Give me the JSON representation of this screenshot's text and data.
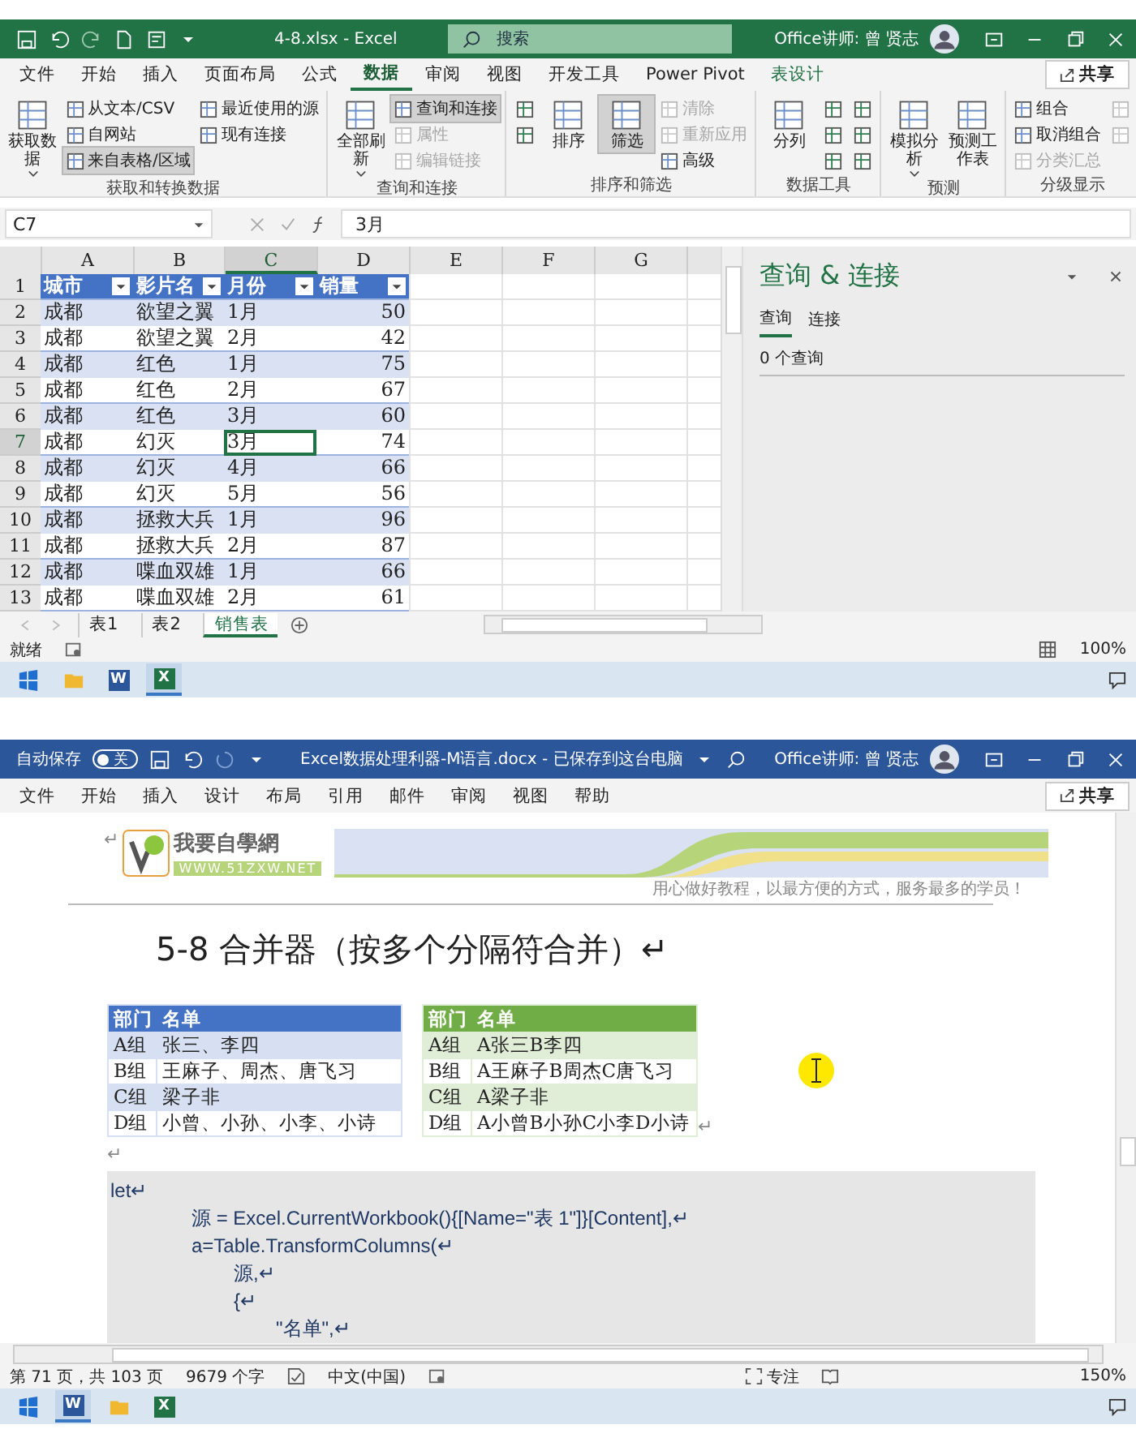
{
  "excel": {
    "title_bar": {
      "filename": "4-8.xlsx  -  Excel",
      "search_placeholder": "搜索",
      "user": "Office讲师: 曾 贤志"
    },
    "menu_tabs": [
      {
        "label": "文件",
        "selected": false,
        "kind": "plain"
      },
      {
        "label": "开始",
        "selected": false,
        "kind": "plain"
      },
      {
        "label": "插入",
        "selected": false,
        "kind": "plain"
      },
      {
        "label": "页面布局",
        "selected": false,
        "kind": "plain"
      },
      {
        "label": "公式",
        "selected": false,
        "kind": "plain"
      },
      {
        "label": "数据",
        "selected": true,
        "kind": "plain"
      },
      {
        "label": "审阅",
        "selected": false,
        "kind": "plain"
      },
      {
        "label": "视图",
        "selected": false,
        "kind": "plain"
      },
      {
        "label": "开发工具",
        "selected": false,
        "kind": "plain"
      },
      {
        "label": "Power Pivot",
        "selected": false,
        "kind": "plain"
      },
      {
        "label": "表设计",
        "selected": false,
        "kind": "contextual"
      }
    ],
    "share": "共享",
    "ribbon": [
      {
        "label": "获取和转换数据",
        "items": [
          {
            "kind": "big",
            "label": "获取数据",
            "dropdown": true,
            "selected": false,
            "disabled": false
          },
          {
            "kind": "stack",
            "entries": [
              {
                "label": "从文本/CSV",
                "disabled": false,
                "selected": false
              },
              {
                "label": "自网站",
                "disabled": false,
                "selected": false
              },
              {
                "label": "来自表格/区域",
                "disabled": false,
                "selected": true
              }
            ]
          },
          {
            "kind": "stack",
            "entries": [
              {
                "label": "最近使用的源",
                "disabled": false,
                "selected": false
              },
              {
                "label": "现有连接",
                "disabled": false,
                "selected": false
              }
            ]
          }
        ]
      },
      {
        "label": "查询和连接",
        "items": [
          {
            "kind": "big",
            "label": "全部刷新",
            "dropdown": true,
            "selected": false,
            "disabled": false
          },
          {
            "kind": "stack",
            "entries": [
              {
                "label": "查询和连接",
                "disabled": false,
                "selected": true
              },
              {
                "label": "属性",
                "disabled": true,
                "selected": false
              },
              {
                "label": "编辑链接",
                "disabled": true,
                "selected": false
              }
            ]
          }
        ]
      },
      {
        "label": "排序和筛选",
        "items": [
          {
            "kind": "iconstack",
            "entries": [
              {
                "disabled": false
              },
              {
                "disabled": false
              }
            ]
          },
          {
            "kind": "big",
            "label": "排序",
            "dropdown": false,
            "selected": false,
            "disabled": false
          },
          {
            "kind": "big",
            "label": "筛选",
            "dropdown": false,
            "selected": true,
            "disabled": false
          },
          {
            "kind": "stack",
            "entries": [
              {
                "label": "清除",
                "disabled": true,
                "selected": false
              },
              {
                "label": "重新应用",
                "disabled": true,
                "selected": false
              },
              {
                "label": "高级",
                "disabled": false,
                "selected": false
              }
            ]
          }
        ]
      },
      {
        "label": "数据工具",
        "items": [
          {
            "kind": "big",
            "label": "分列",
            "dropdown": false,
            "selected": false,
            "disabled": false
          },
          {
            "kind": "iconstack",
            "entries": [
              {
                "disabled": false
              },
              {
                "disabled": false
              },
              {
                "disabled": false
              }
            ]
          },
          {
            "kind": "iconstack",
            "entries": [
              {
                "disabled": false
              },
              {
                "disabled": false
              },
              {
                "disabled": false
              }
            ]
          }
        ]
      },
      {
        "label": "预测",
        "items": [
          {
            "kind": "big",
            "label": "模拟分析",
            "dropdown": true,
            "selected": false,
            "disabled": false
          },
          {
            "kind": "big",
            "label": "预测工作表",
            "dropdown": false,
            "selected": false,
            "disabled": false
          }
        ]
      },
      {
        "label": "分级显示",
        "items": [
          {
            "kind": "stack",
            "entries": [
              {
                "label": "组合",
                "disabled": false,
                "selected": false
              },
              {
                "label": "取消组合",
                "disabled": false,
                "selected": false
              },
              {
                "label": "分类汇总",
                "disabled": true,
                "selected": false
              }
            ]
          },
          {
            "kind": "iconstack",
            "entries": [
              {
                "disabled": true
              },
              {
                "disabled": true
              }
            ]
          }
        ]
      }
    ],
    "name_box": "C7",
    "formula": "3月",
    "columns": [
      "A",
      "B",
      "C",
      "D",
      "E",
      "F",
      "G"
    ],
    "header_row_number": "1",
    "table_header": [
      "城市",
      "影片名",
      "月份",
      "销量"
    ],
    "rows": [
      {
        "number": "2",
        "cells": [
          {
            "text": "成都",
            "selected": false
          },
          {
            "text": "欲望之翼",
            "selected": false
          },
          {
            "text": "1月",
            "selected": false
          },
          {
            "text": "50",
            "selected": false
          }
        ]
      },
      {
        "number": "3",
        "cells": [
          {
            "text": "成都",
            "selected": false
          },
          {
            "text": "欲望之翼",
            "selected": false
          },
          {
            "text": "2月",
            "selected": false
          },
          {
            "text": "42",
            "selected": false
          }
        ]
      },
      {
        "number": "4",
        "cells": [
          {
            "text": "成都",
            "selected": false
          },
          {
            "text": "红色",
            "selected": false
          },
          {
            "text": "1月",
            "selected": false
          },
          {
            "text": "75",
            "selected": false
          }
        ]
      },
      {
        "number": "5",
        "cells": [
          {
            "text": "成都",
            "selected": false
          },
          {
            "text": "红色",
            "selected": false
          },
          {
            "text": "2月",
            "selected": false
          },
          {
            "text": "67",
            "selected": false
          }
        ]
      },
      {
        "number": "6",
        "cells": [
          {
            "text": "成都",
            "selected": false
          },
          {
            "text": "红色",
            "selected": false
          },
          {
            "text": "3月",
            "selected": false
          },
          {
            "text": "60",
            "selected": false
          }
        ]
      },
      {
        "number": "7",
        "cells": [
          {
            "text": "成都",
            "selected": false
          },
          {
            "text": "幻灭",
            "selected": false
          },
          {
            "text": "3月",
            "selected": true
          },
          {
            "text": "74",
            "selected": false
          }
        ]
      },
      {
        "number": "8",
        "cells": [
          {
            "text": "成都",
            "selected": false
          },
          {
            "text": "幻灭",
            "selected": false
          },
          {
            "text": "4月",
            "selected": false
          },
          {
            "text": "66",
            "selected": false
          }
        ]
      },
      {
        "number": "9",
        "cells": [
          {
            "text": "成都",
            "selected": false
          },
          {
            "text": "幻灭",
            "selected": false
          },
          {
            "text": "5月",
            "selected": false
          },
          {
            "text": "56",
            "selected": false
          }
        ]
      },
      {
        "number": "10",
        "cells": [
          {
            "text": "成都",
            "selected": false
          },
          {
            "text": "拯救大兵",
            "selected": false
          },
          {
            "text": "1月",
            "selected": false
          },
          {
            "text": "96",
            "selected": false
          }
        ]
      },
      {
        "number": "11",
        "cells": [
          {
            "text": "成都",
            "selected": false
          },
          {
            "text": "拯救大兵",
            "selected": false
          },
          {
            "text": "2月",
            "selected": false
          },
          {
            "text": "87",
            "selected": false
          }
        ]
      },
      {
        "number": "12",
        "cells": [
          {
            "text": "成都",
            "selected": false
          },
          {
            "text": "喋血双雄",
            "selected": false
          },
          {
            "text": "1月",
            "selected": false
          },
          {
            "text": "66",
            "selected": false
          }
        ]
      },
      {
        "number": "13",
        "cells": [
          {
            "text": "成都",
            "selected": false
          },
          {
            "text": "喋血双雄",
            "selected": false
          },
          {
            "text": "2月",
            "selected": false
          },
          {
            "text": "61",
            "selected": false
          }
        ]
      }
    ],
    "sheet_tabs": [
      {
        "label": "表1",
        "selected": false
      },
      {
        "label": "表2",
        "selected": false
      },
      {
        "label": "销售表",
        "selected": true
      }
    ],
    "query_pane": {
      "title": "查询 & 连接",
      "tabs": [
        {
          "label": "查询",
          "selected": true
        },
        {
          "label": "连接",
          "selected": false
        }
      ],
      "summary": "0 个查询"
    },
    "status": {
      "text": "就绪",
      "zoom": "100%"
    },
    "taskbar": [
      {
        "kind": "start",
        "active": false
      },
      {
        "kind": "explorer",
        "active": false
      },
      {
        "kind": "word",
        "letter": "W",
        "active": false
      },
      {
        "kind": "excel",
        "letter": "X",
        "active": true
      }
    ]
  },
  "word": {
    "title_bar": {
      "autosave_label": "自动保存",
      "autosave": {
        "on": false,
        "label": "关"
      },
      "filename": "Excel数据处理利器-M语言.docx  -  已保存到这台电脑",
      "user": "Office讲师: 曾 贤志"
    },
    "menu_tabs": [
      {
        "label": "文件",
        "selected": false
      },
      {
        "label": "开始",
        "selected": false
      },
      {
        "label": "插入",
        "selected": false
      },
      {
        "label": "设计",
        "selected": false
      },
      {
        "label": "布局",
        "selected": false
      },
      {
        "label": "引用",
        "selected": false
      },
      {
        "label": "邮件",
        "selected": false
      },
      {
        "label": "审阅",
        "selected": false
      },
      {
        "label": "视图",
        "selected": false
      },
      {
        "label": "帮助",
        "selected": false
      }
    ],
    "share": "共享",
    "document": {
      "header": {
        "mark": "↵",
        "logo_title": "我要自學網",
        "logo_url": "WWW.51ZXW.NET",
        "tagline": "用心做好教程，以最方便的方式，服务最多的学员！"
      },
      "heading": "5-8 合并器（按多个分隔符合并）↵",
      "tables": [
        {
          "color": "#4472c4",
          "columns": [
            "部门",
            "名单"
          ],
          "rows": [
            [
              "A组",
              "张三、李四"
            ],
            [
              "B组",
              "王麻子、周杰、唐飞习"
            ],
            [
              "C组",
              "梁子非"
            ],
            [
              "D组",
              "小曾、小孙、小李、小诗"
            ]
          ]
        },
        {
          "color": "#70ad47",
          "columns": [
            "部门",
            "名单"
          ],
          "rows": [
            [
              "A组",
              "A张三B李四"
            ],
            [
              "B组",
              "A王麻子B周杰C唐飞习"
            ],
            [
              "C组",
              "A梁子非"
            ],
            [
              "D组",
              "A小曾B小孙C小李D小诗"
            ]
          ]
        }
      ],
      "table_end_mark": "↵",
      "empty_paragraph": "↵",
      "code": [
        {
          "text": "let↵",
          "children": [
            {
              "text": "源  = Excel.CurrentWorkbook(){[Name=\"表 1\"]}[Content],↵"
            },
            {
              "text": "a=Table.TransformColumns(↵",
              "children": [
                {
                  "text": "源,↵"
                },
                {
                  "text": "{↵",
                  "children": [
                    {
                      "text": "\"名单\",↵"
                    }
                  ]
                }
              ]
            }
          ]
        }
      ]
    },
    "status": {
      "page": "第 71 页，共 103 页",
      "words": "9679 个字",
      "language": "中文(中国)",
      "focus": "专注",
      "zoom": "150%"
    },
    "taskbar": [
      {
        "kind": "start",
        "active": false
      },
      {
        "kind": "word",
        "letter": "W",
        "active": true
      },
      {
        "kind": "explorer",
        "active": false
      },
      {
        "kind": "excel",
        "letter": "X",
        "active": false
      }
    ]
  }
}
